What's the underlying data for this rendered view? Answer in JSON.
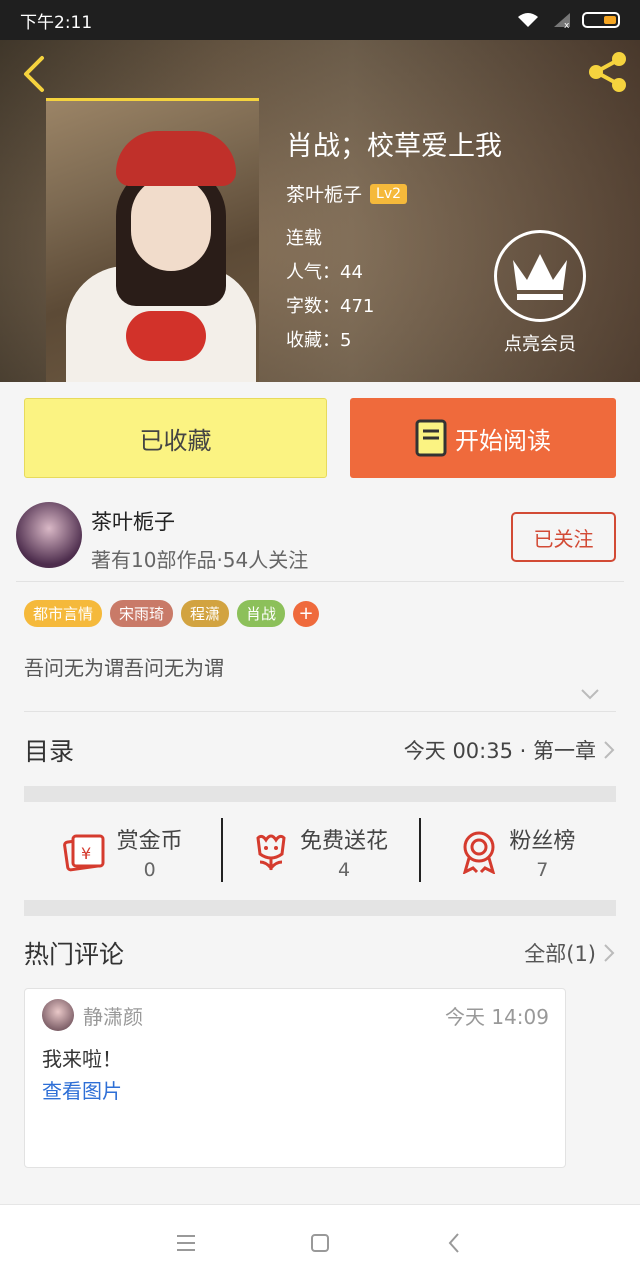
{
  "status_bar": {
    "time": "下午2:11"
  },
  "book": {
    "title": "肖战；校草爱上我",
    "author": "茶叶栀子",
    "level": "Lv2",
    "status": "连载",
    "popularity": "人气：44",
    "word_count": "字数：471",
    "favorites": "收藏：5"
  },
  "vip": {
    "label": "点亮会员",
    "icon": "crown-icon"
  },
  "actions": {
    "favorite_label": "已收藏",
    "read_label": "开始阅读"
  },
  "author": {
    "name": "茶叶栀子",
    "stats": "著有10部作品·54人关注",
    "follow_label": "已关注"
  },
  "tags": [
    {
      "label": "都市言情",
      "color": "#f5b93b"
    },
    {
      "label": "宋雨琦",
      "color": "#c97a68"
    },
    {
      "label": "程潇",
      "color": "#d2a340"
    },
    {
      "label": "肖战",
      "color": "#8cc05a"
    }
  ],
  "tag_more": "+",
  "summary": "吾问无为谓吾问无为谓",
  "toc": {
    "title": "目录",
    "latest": "今天 00:35 · 第一章"
  },
  "stats": [
    {
      "label": "赏金币",
      "value": "0",
      "icon": "red-envelope-icon"
    },
    {
      "label": "免费送花",
      "value": "4",
      "icon": "flower-icon"
    },
    {
      "label": "粉丝榜",
      "value": "7",
      "icon": "ribbon-badge-icon"
    }
  ],
  "comments": {
    "title": "热门评论",
    "all_label": "全部(1)",
    "items": [
      {
        "user": "静潇颜",
        "time": "今天 14:09",
        "text": "我来啦！",
        "link": "查看图片"
      }
    ]
  },
  "colors": {
    "accent": "#ef6a3c",
    "favorite_bg": "#fbf382",
    "follow": "#d24a35",
    "link": "#2e6fd6"
  }
}
